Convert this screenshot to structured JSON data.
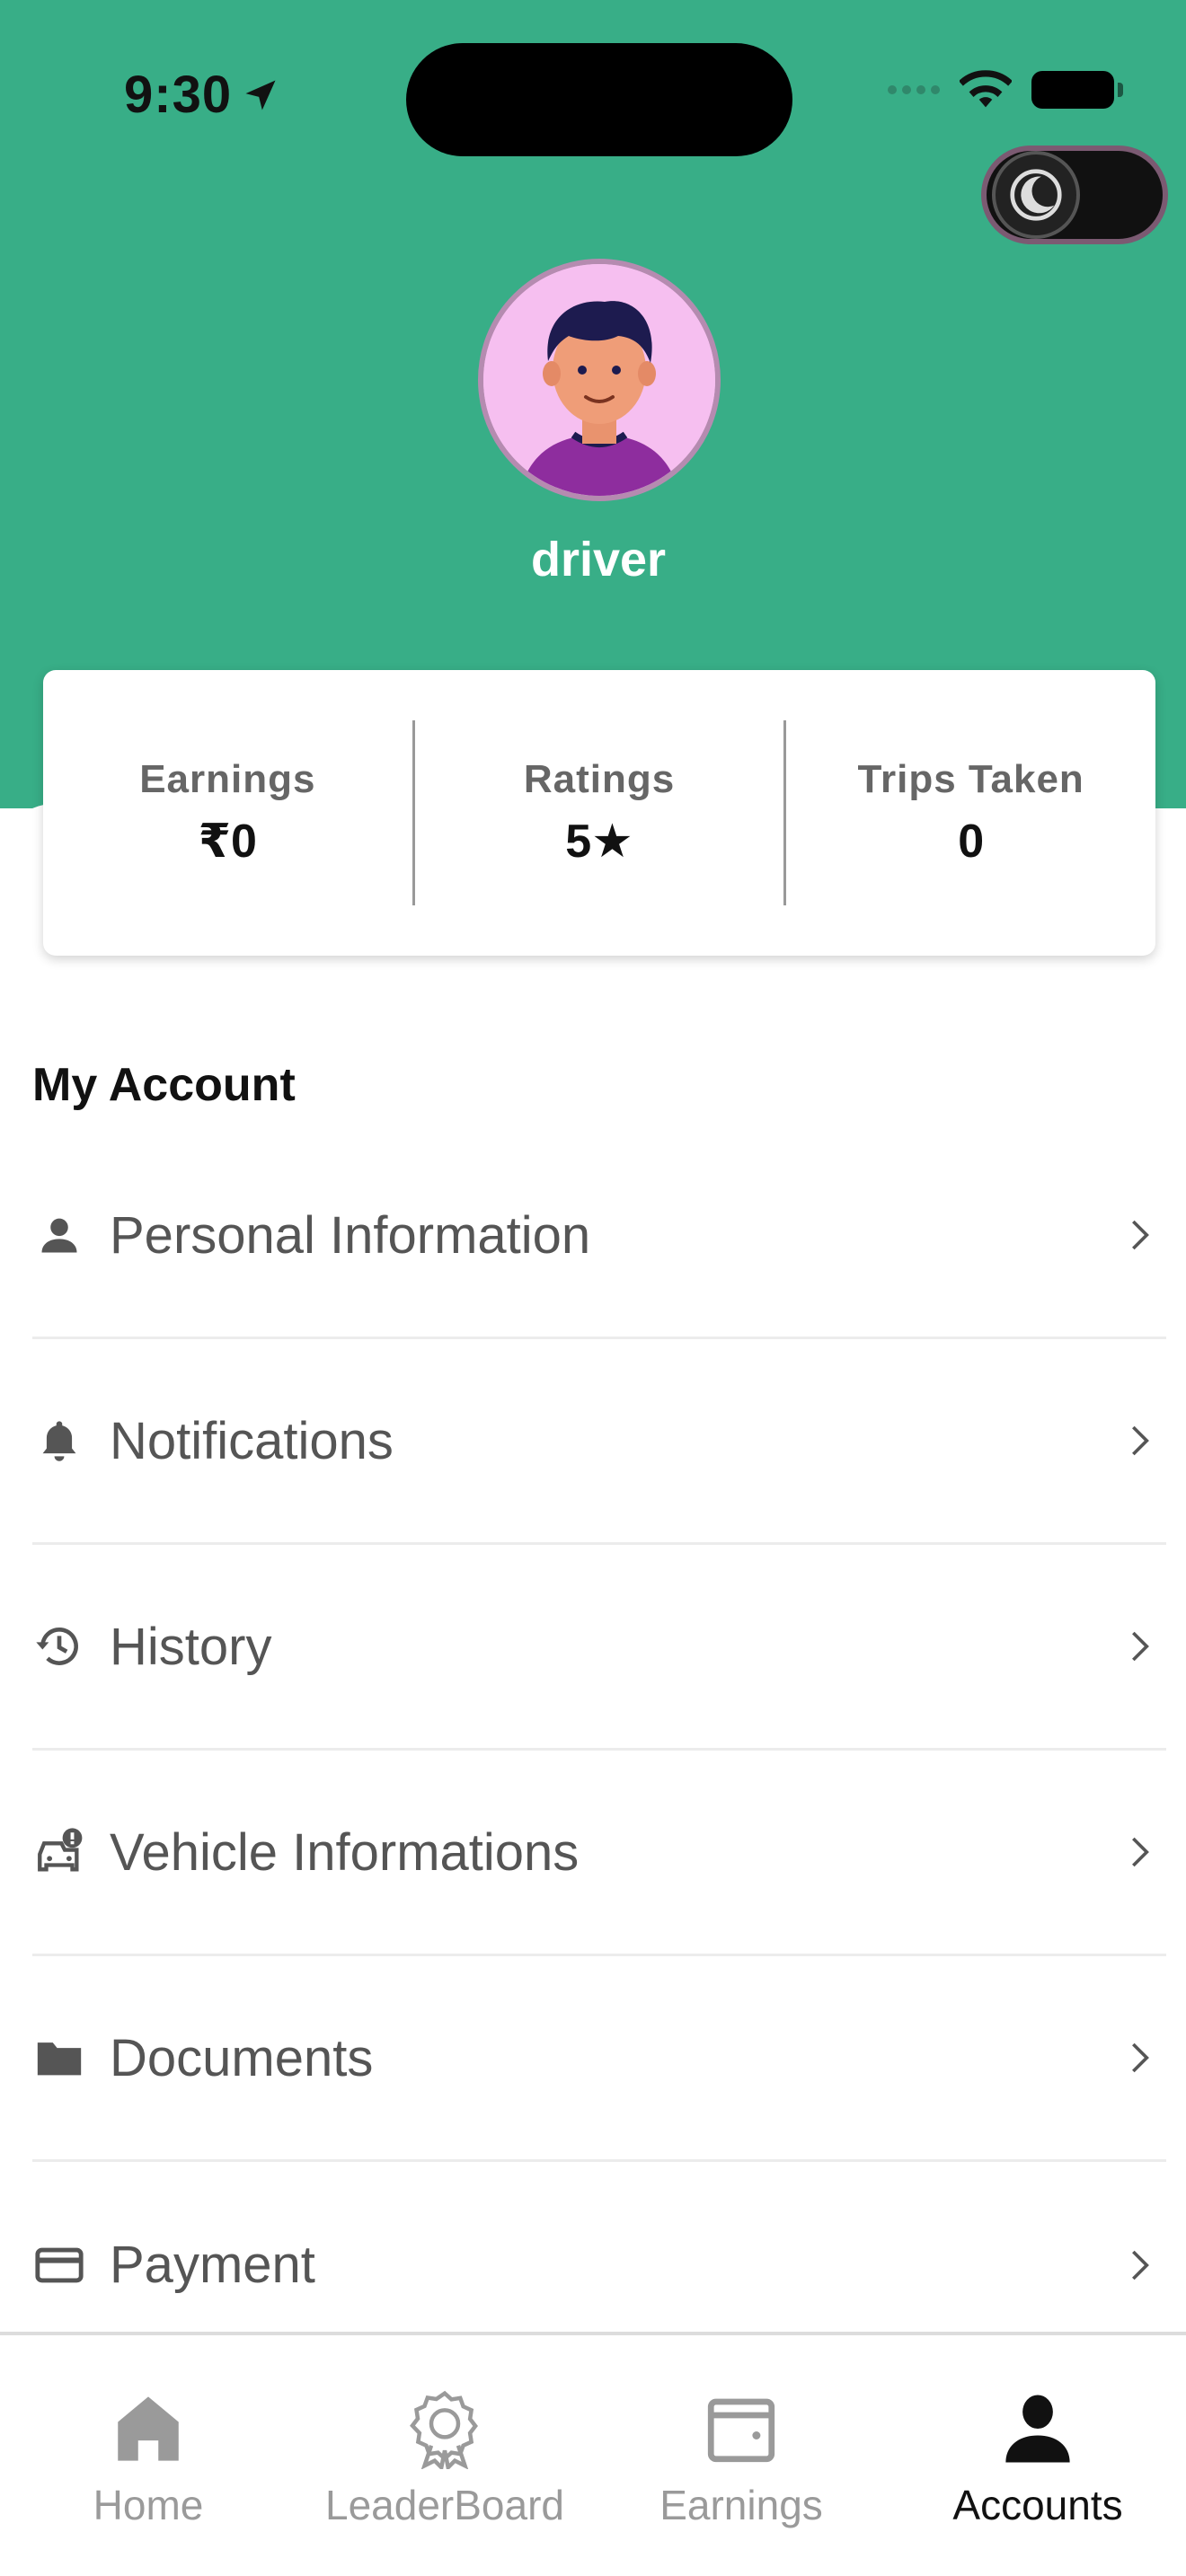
{
  "status_bar": {
    "time": "9:30"
  },
  "profile": {
    "username": "driver"
  },
  "stats": {
    "earnings_label": "Earnings",
    "earnings_value": "₹0",
    "ratings_label": "Ratings",
    "ratings_value": "5★",
    "trips_label": "Trips Taken",
    "trips_value": "0"
  },
  "section": {
    "title": "My Account"
  },
  "menu": {
    "items": [
      {
        "label": "Personal Information",
        "icon": "person-icon"
      },
      {
        "label": "Notifications",
        "icon": "bell-icon"
      },
      {
        "label": "History",
        "icon": "history-icon"
      },
      {
        "label": "Vehicle Informations",
        "icon": "car-alert-icon"
      },
      {
        "label": "Documents",
        "icon": "folder-icon"
      },
      {
        "label": "Payment",
        "icon": "credit-card-icon"
      }
    ]
  },
  "bottom_nav": {
    "items": [
      {
        "label": "Home",
        "icon": "home-icon",
        "active": false
      },
      {
        "label": "LeaderBoard",
        "icon": "award-icon",
        "active": false
      },
      {
        "label": "Earnings",
        "icon": "wallet-icon",
        "active": false
      },
      {
        "label": "Accounts",
        "icon": "user-icon",
        "active": true
      }
    ]
  },
  "colors": {
    "header_green": "#38ae87",
    "active_nav": "#111111",
    "inactive_nav": "#9a9a9a"
  }
}
